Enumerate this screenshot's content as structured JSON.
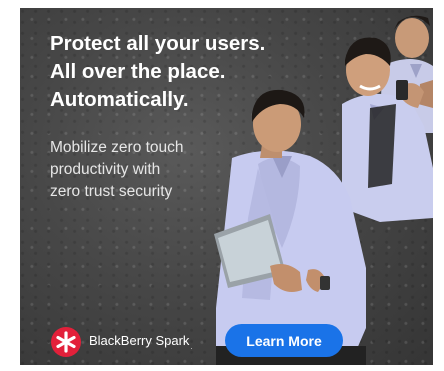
{
  "headline": {
    "line1": "Protect all your users.",
    "line2": "All over the place.",
    "line3": "Automatically."
  },
  "subheadline": {
    "line1": "Mobilize zero touch",
    "line2": "productivity with",
    "line3": "zero trust security"
  },
  "brand": {
    "name": "BlackBerry Spark",
    "trademark": ".",
    "logo_icon": "blackberry-spark-star-icon",
    "logo_color": "#e2203a"
  },
  "cta": {
    "label": "Learn More",
    "color": "#1a73e8"
  },
  "image": {
    "description_icon": "people-with-devices-illustration"
  }
}
